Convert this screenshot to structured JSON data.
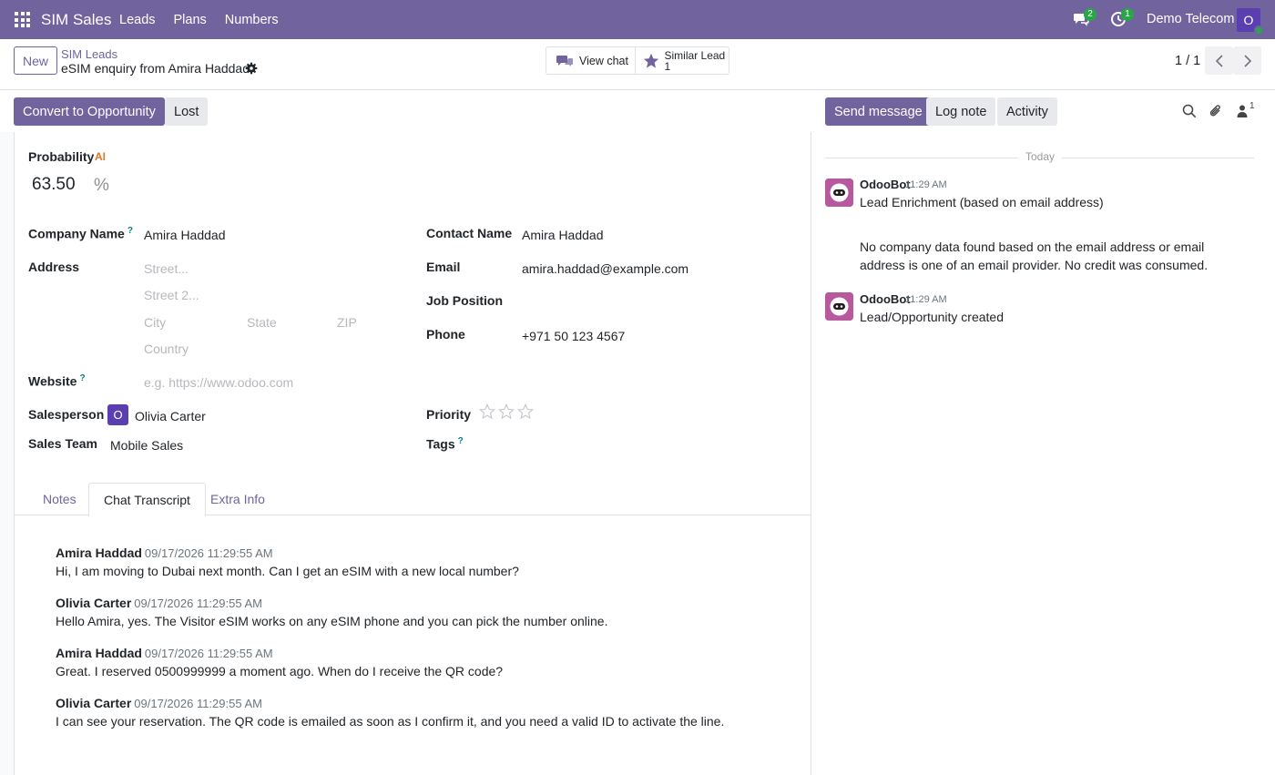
{
  "navbar": {
    "app_name": "SIM Sales",
    "menu": [
      "Leads",
      "Plans",
      "Numbers"
    ],
    "chat_badge": "2",
    "activity_badge": "1",
    "company": "Demo Telecom",
    "user_initial": "O"
  },
  "control": {
    "new_label": "New",
    "breadcrumb_parent": "SIM Leads",
    "breadcrumb_current": "eSIM enquiry from Amira Haddad",
    "view_chat_label": "View chat",
    "similar_lead_label": "Similar Lead",
    "similar_lead_count": "1",
    "pager": "1 / 1"
  },
  "status": {
    "convert_label": "Convert to Opportunity",
    "lost_label": "Lost"
  },
  "form": {
    "probability_label": "Probability",
    "ai_label": "AI",
    "probability_value": "63.50",
    "percent": "%",
    "company_name_label": "Company Name",
    "company_name_value": "Amira Haddad",
    "address_label": "Address",
    "street_ph": "Street...",
    "street2_ph": "Street 2...",
    "city_ph": "City",
    "state_ph": "State",
    "zip_ph": "ZIP",
    "country_ph": "Country",
    "website_label": "Website",
    "website_ph": "e.g. https://www.odoo.com",
    "salesperson_label": "Salesperson",
    "salesperson_initial": "O",
    "salesperson_value": "Olivia Carter",
    "sales_team_label": "Sales Team",
    "sales_team_value": "Mobile Sales",
    "contact_name_label": "Contact Name",
    "contact_name_value": "Amira Haddad",
    "email_label": "Email",
    "email_value": "amira.haddad@example.com",
    "job_position_label": "Job Position",
    "phone_label": "Phone",
    "phone_value": "+971 50 123 4567",
    "priority_label": "Priority",
    "priority_stars": 0,
    "tags_label": "Tags",
    "help_mark": "?"
  },
  "tabs": [
    "Notes",
    "Chat Transcript",
    "Extra Info"
  ],
  "active_tab": "Chat Transcript",
  "transcript": [
    {
      "author": "Amira Haddad",
      "date": "09/17/2026 11:29:55 AM",
      "body": "Hi, I am moving to Dubai next month. Can I get an eSIM with a new local number?"
    },
    {
      "author": "Olivia Carter",
      "date": "09/17/2026 11:29:55 AM",
      "body": "Hello Amira, yes. The Visitor eSIM works on any eSIM phone and you can pick the number online."
    },
    {
      "author": "Amira Haddad",
      "date": "09/17/2026 11:29:55 AM",
      "body": "Great. I reserved 0500999999 a moment ago. When do I receive the QR code?"
    },
    {
      "author": "Olivia Carter",
      "date": "09/17/2026 11:29:55 AM",
      "body": "I can see your reservation. The QR code is emailed as soon as I confirm it, and you need a valid ID to activate the line."
    }
  ],
  "chatter": {
    "send_message_label": "Send message",
    "log_note_label": "Log note",
    "activity_label": "Activity",
    "followers_count": "1",
    "day_label": "Today",
    "messages": [
      {
        "author": "OdooBot",
        "time": "11:29 AM",
        "line1": "Lead Enrichment (based on email address)",
        "line2": "No company data found based on the email address or email address is one of an email provider. No credit was consumed."
      },
      {
        "author": "OdooBot",
        "time": "11:29 AM",
        "line1": "Lead/Opportunity created"
      }
    ]
  },
  "colors": {
    "brand": "#71639e",
    "badge_green": "#28a745",
    "avatar_purple": "#5b3fb1"
  }
}
